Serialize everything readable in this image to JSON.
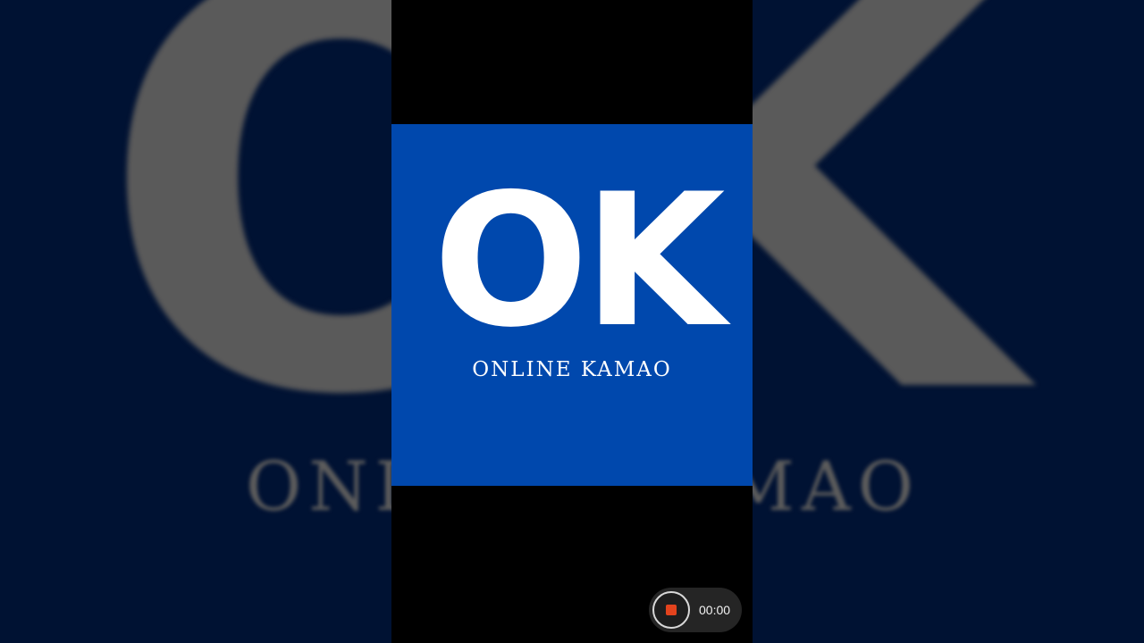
{
  "colors": {
    "background": "#001233",
    "logo_blue": "#0048ad",
    "logo_text": "#ffffff",
    "stop_red": "#e3431d"
  },
  "logo": {
    "mark": "OK",
    "tagline": "ONLINE KAMAO"
  },
  "recorder": {
    "stop_icon": "stop-icon",
    "timer": "00:00"
  }
}
